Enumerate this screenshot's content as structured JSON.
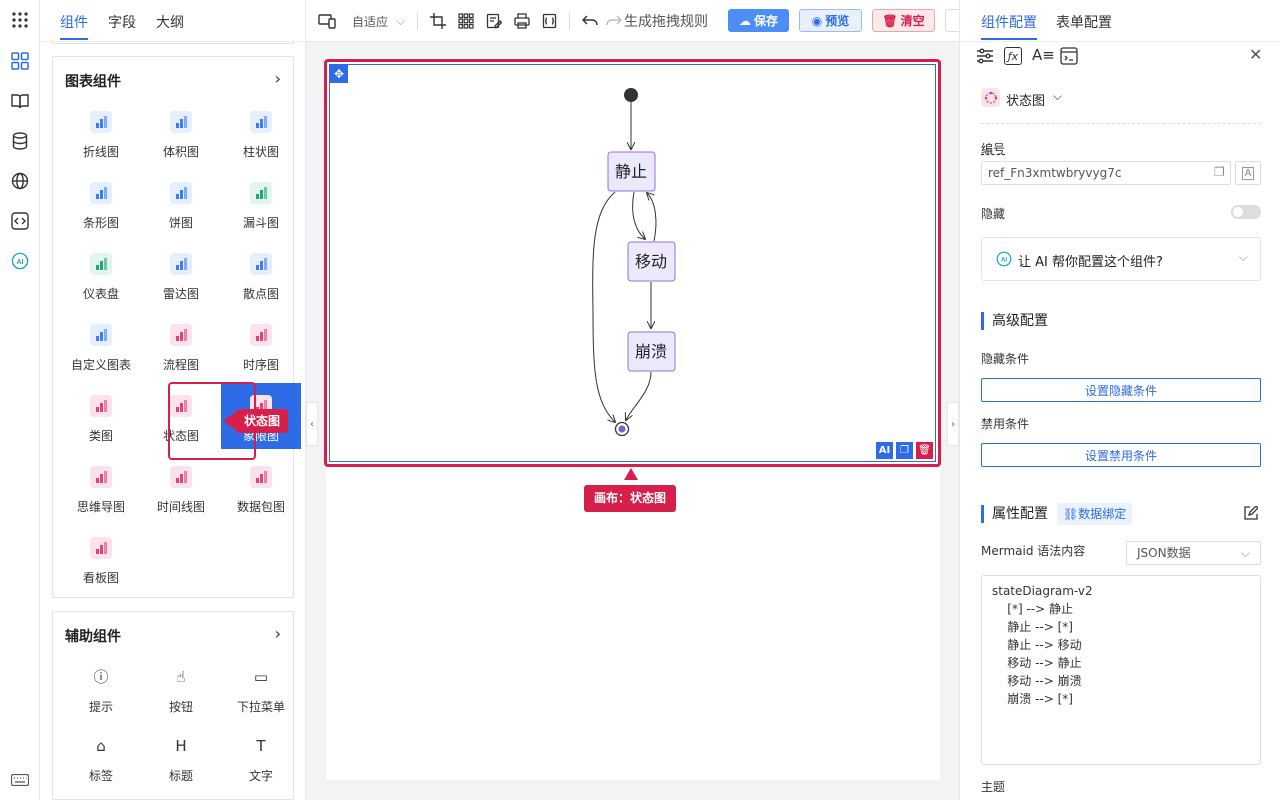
{
  "left_tabs": [
    "组件",
    "字段",
    "大纲"
  ],
  "chart_panel": {
    "title": "图表组件",
    "items": [
      {
        "label": "折线图",
        "icon": "line-chart-icon",
        "color": "#3c7df0"
      },
      {
        "label": "体积图",
        "icon": "area-chart-icon",
        "color": "#3c7df0"
      },
      {
        "label": "柱状图",
        "icon": "bar-chart-icon",
        "color": "#3c7df0"
      },
      {
        "label": "条形图",
        "icon": "hbar-chart-icon",
        "color": "#3c7df0"
      },
      {
        "label": "饼图",
        "icon": "pie-chart-icon",
        "color": "#3c7df0"
      },
      {
        "label": "漏斗图",
        "icon": "funnel-chart-icon",
        "color": "#1fa87a"
      },
      {
        "label": "仪表盘",
        "icon": "gauge-chart-icon",
        "color": "#1fa87a"
      },
      {
        "label": "雷达图",
        "icon": "radar-chart-icon",
        "color": "#3c7df0"
      },
      {
        "label": "散点图",
        "icon": "scatter-chart-icon",
        "color": "#3c7df0"
      },
      {
        "label": "自定义图表",
        "icon": "custom-chart-icon",
        "color": "#3c7df0"
      },
      {
        "label": "流程图",
        "icon": "flow-chart-icon",
        "color": "#e0437a"
      },
      {
        "label": "时序图",
        "icon": "sequence-chart-icon",
        "color": "#e0437a"
      },
      {
        "label": "类图",
        "icon": "class-diagram-icon",
        "color": "#e0437a"
      },
      {
        "label": "状态图",
        "icon": "state-diagram-icon",
        "color": "#e0437a"
      },
      {
        "label": "象限图",
        "icon": "quadrant-chart-icon",
        "color": "#e0437a"
      },
      {
        "label": "思维导图",
        "icon": "mindmap-icon",
        "color": "#e0437a"
      },
      {
        "label": "时间线图",
        "icon": "timeline-icon",
        "color": "#e0437a"
      },
      {
        "label": "数据包图",
        "icon": "packet-chart-icon",
        "color": "#e0437a"
      },
      {
        "label": "看板图",
        "icon": "kanban-icon",
        "color": "#e0437a"
      }
    ]
  },
  "tip_left": "状态图",
  "aux_panel": {
    "title": "辅助组件",
    "items": [
      {
        "label": "提示",
        "icon": "info-icon"
      },
      {
        "label": "按钮",
        "icon": "button-icon"
      },
      {
        "label": "下拉菜单",
        "icon": "dropdown-icon"
      },
      {
        "label": "标签",
        "icon": "tag-icon"
      },
      {
        "label": "标题",
        "icon": "heading-icon"
      },
      {
        "label": "文字",
        "icon": "text-icon"
      }
    ]
  },
  "toolbar": {
    "adapt": "自适应",
    "rules": "生成拖拽规则",
    "save": "保存",
    "preview": "预览",
    "clear": "清空"
  },
  "diagram": {
    "nodes": [
      "静止",
      "移动",
      "崩溃"
    ]
  },
  "canvas_tip": "画布：状态图",
  "right_tabs": [
    "组件配置",
    "表单配置"
  ],
  "component": {
    "name": "状态图",
    "id_label": "编号",
    "id_value": "ref_Fn3xmtwbryvyg7c",
    "hide_label": "隐藏",
    "ai_text": "让 AI 帮你配置这个组件?"
  },
  "advanced": {
    "title": "高级配置",
    "hide_cond": "隐藏条件",
    "hide_btn": "设置隐藏条件",
    "disable_cond": "禁用条件",
    "disable_btn": "设置禁用条件"
  },
  "props": {
    "title": "属性配置",
    "bind": "数据绑定",
    "mermaid_label": "Mermaid 语法内容",
    "mode": "JSON数据",
    "code": [
      "stateDiagram-v2",
      "    [*] --> 静止",
      "    静止 --> [*]",
      "    静止 --> 移动",
      "    移动 --> 静止",
      "    移动 --> 崩溃",
      "    崩溃 --> [*]"
    ],
    "theme": "主题"
  }
}
